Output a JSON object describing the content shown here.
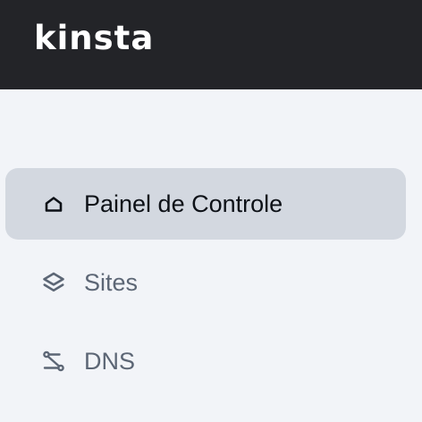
{
  "brand": {
    "logo_text": "kinsta"
  },
  "sidebar": {
    "items": [
      {
        "label": "Painel de Controle",
        "icon": "home-icon",
        "active": true
      },
      {
        "label": "Sites",
        "icon": "layers-icon",
        "active": false
      },
      {
        "label": "DNS",
        "icon": "route-icon",
        "active": false
      }
    ]
  },
  "colors": {
    "topbar": "#232428",
    "background": "#f2f4f8",
    "active_item": "#d3d8e0",
    "active_text": "#0d1117",
    "inactive_text": "#5c6675"
  }
}
